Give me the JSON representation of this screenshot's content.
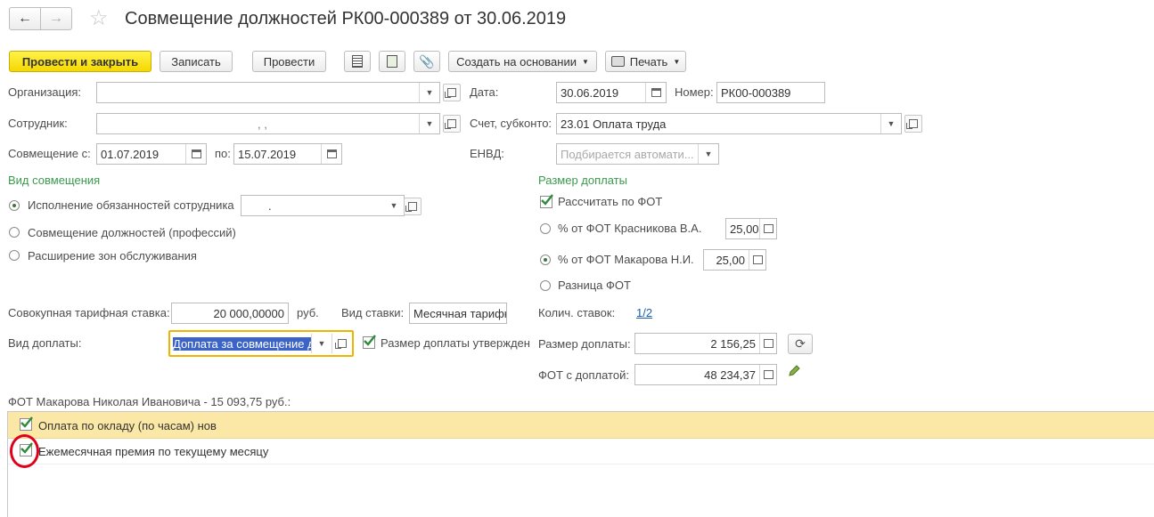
{
  "header": {
    "title": "Совмещение должностей РК00-000389 от 30.06.2019"
  },
  "toolbar": {
    "post_close": "Провести и закрыть",
    "save": "Записать",
    "post": "Провести",
    "create_based": "Создать на основании",
    "print": "Печать"
  },
  "form": {
    "organization_label": "Организация:",
    "organization_value": "",
    "employee_label": "Сотрудник:",
    "employee_value": ", ,",
    "combine_from_label": "Совмещение с:",
    "combine_from_value": "01.07.2019",
    "combine_to_label": "по:",
    "combine_to_value": "15.07.2019",
    "date_label": "Дата:",
    "date_value": "30.06.2019",
    "number_label": "Номер:",
    "number_value": "РК00-000389",
    "account_label": "Счет, субконто:",
    "account_value": "23.01 Оплата труда",
    "envd_label": "ЕНВД:",
    "envd_placeholder": "Подбирается автомати..."
  },
  "kind_section": {
    "title": "Вид совмещения",
    "options": [
      "Исполнение обязанностей сотрудника",
      "Совмещение должностей (профессий)",
      "Расширение зон обслуживания"
    ],
    "selected_index": 0,
    "employee_field_value": "."
  },
  "pay_section": {
    "title": "Размер доплаты",
    "calc_by_fot_label": "Рассчитать по ФОТ",
    "calc_by_fot_checked": true,
    "option1_label": "% от ФОТ Красникова В.А.",
    "option1_value": "25,00",
    "option2_label": "% от ФОТ Макарова Н.И.",
    "option2_value": "25,00",
    "option3_label": "Разница ФОТ",
    "selected_index": 1
  },
  "rates": {
    "total_rate_label": "Совокупная тарифная ставка:",
    "total_rate_value": "20 000,00000",
    "currency": "руб.",
    "rate_kind_label": "Вид ставки:",
    "rate_kind_value": "Месячная тарифн",
    "surcharge_kind_label": "Вид доплаты:",
    "surcharge_kind_value": "Доплата за совмещение д",
    "approved_label": "Размер доплаты утвержден",
    "approved_checked": true,
    "count_label": "Колич. ставок:",
    "count_value": "1/2",
    "surcharge_amount_label": "Размер доплаты:",
    "surcharge_amount_value": "2 156,25",
    "fot_with_label": "ФОТ с доплатой:",
    "fot_with_value": "48 234,37"
  },
  "fot_list": {
    "caption": "ФОТ Макарова Николая Ивановича - 15 093,75 руб.:",
    "rows": [
      {
        "label": "Оплата по окладу (по часам) нов",
        "checked": true
      },
      {
        "label": "Ежемесячная премия по текущему месяцу",
        "checked": true
      }
    ]
  },
  "colors": {
    "accent_green": "#3b9a4e",
    "primary_button": "#f5d800",
    "selected_row": "#fbe8a6",
    "focus_border": "#f0b400",
    "annotation_red": "#e0001b"
  }
}
